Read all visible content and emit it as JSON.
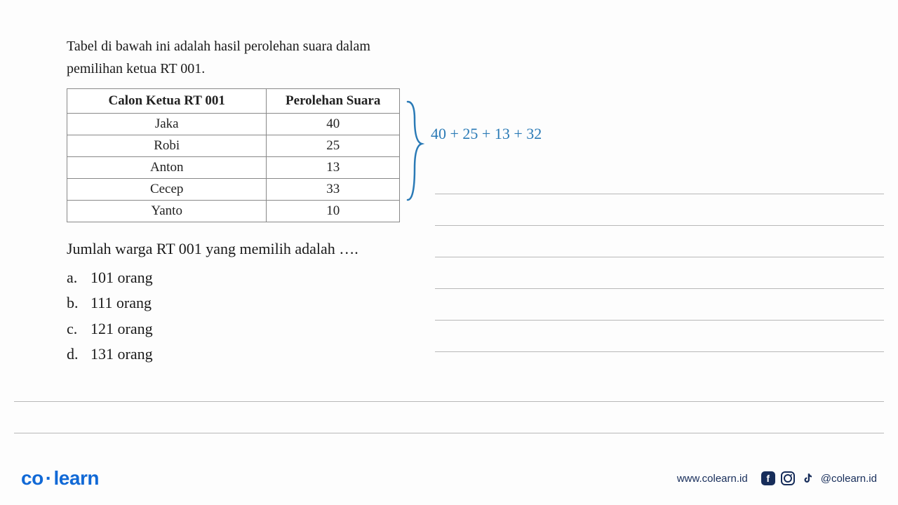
{
  "intro": {
    "line1": "Tabel di bawah ini adalah hasil perolehan suara dalam",
    "line2": "pemilihan ketua RT 001."
  },
  "table": {
    "header_candidate": "Calon Ketua RT 001",
    "header_votes": "Perolehan Suara",
    "rows": [
      {
        "name": "Jaka",
        "votes": "40"
      },
      {
        "name": "Robi",
        "votes": "25"
      },
      {
        "name": "Anton",
        "votes": "13"
      },
      {
        "name": "Cecep",
        "votes": "33"
      },
      {
        "name": "Yanto",
        "votes": "10"
      }
    ]
  },
  "question": "Jumlah warga RT 001 yang memilih adalah ….",
  "options": [
    {
      "letter": "a.",
      "text": "101 orang"
    },
    {
      "letter": "b.",
      "text": "111 orang"
    },
    {
      "letter": "c.",
      "text": "121 orang"
    },
    {
      "letter": "d.",
      "text": "131 orang"
    }
  ],
  "annotation": "40 + 25 + 13 + 32",
  "footer": {
    "logo_co": "co",
    "logo_learn": "learn",
    "website": "www.colearn.id",
    "handle": "@colearn.id"
  }
}
